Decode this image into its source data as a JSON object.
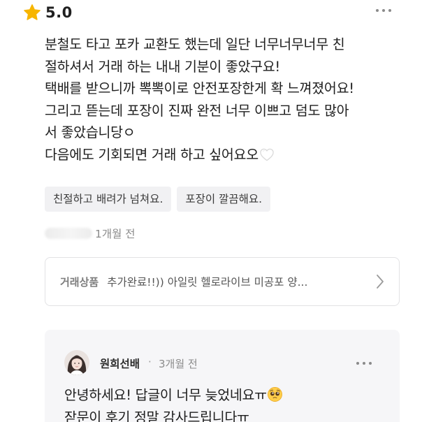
{
  "review": {
    "rating": "5.0",
    "icons": {
      "rating": "star-icon",
      "more": "more-horizontal-icon",
      "heart": "white-heart-icon"
    },
    "colors": {
      "star": "#f7b500",
      "tag_bg": "#f1f1f3",
      "reply_bg": "#f6f6f8"
    },
    "lines": [
      "분철도 타고 포카 교환도 했는데 일단 너무너무너무 친",
      "절하셔서 거래 하는 내내 기분이 좋았구요!",
      "택배를 받으니까 뽁뽁이로 안전포장한게 확 느껴졌어요!",
      "그리고 뜯는데 포장이 진짜 완전 너무 이쁘고 덤도 많아",
      "서 좋았습니당ㅇ",
      "다음에도 기회되면 거래 하고 싶어요오"
    ],
    "tags": [
      "친절하고 배려가 넘쳐요.",
      "포장이 깔끔해요."
    ],
    "time": "1개월 전"
  },
  "product": {
    "label": "거래상품",
    "name": "추가완료!!)) 아일릿 헬로라이브 미공포 양...",
    "icon": "chevron-right-icon"
  },
  "reply": {
    "author": "원희선배",
    "separator": "·",
    "time": "3개월 전",
    "lines": [
      "안녕하세요! 답글이 너무 늦었네요ㅠ",
      "잗문이 후기 정말 감사드립니다ㅠ"
    ],
    "emoji": "pleading-face-icon"
  }
}
